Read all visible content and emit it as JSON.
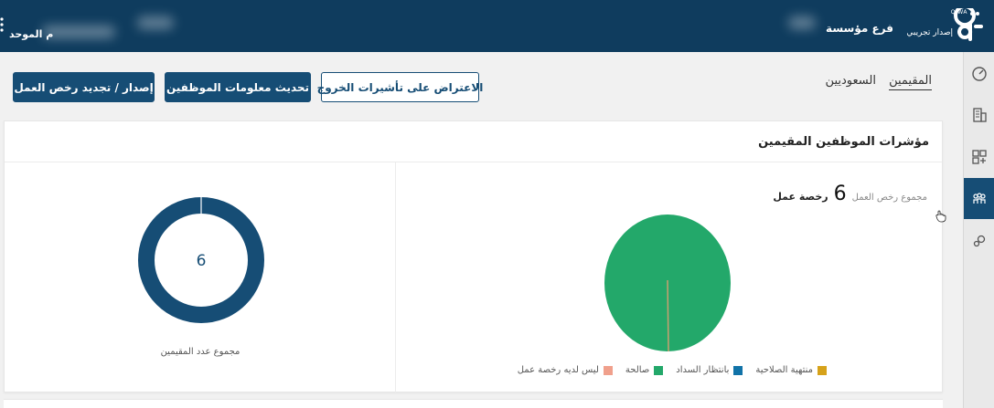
{
  "header": {
    "logo_label": "QIWA",
    "brand_caption": "إصدار تجريبي",
    "branch": "فرع مؤسسة",
    "unified_number_suffix": "م الموحد"
  },
  "sidebar": {
    "items": [
      {
        "icon": "dashboard-icon",
        "active": false
      },
      {
        "icon": "building-icon",
        "active": false
      },
      {
        "icon": "apps-add-icon",
        "active": false
      },
      {
        "icon": "employees-icon",
        "active": true
      },
      {
        "icon": "settings-gears-icon",
        "active": false
      }
    ]
  },
  "tabs": [
    {
      "label": "المقيمين",
      "active": true
    },
    {
      "label": "السعوديين",
      "active": false
    }
  ],
  "actions": {
    "exit_visa_objection": "الاعتراض على تأشيرات الخروج",
    "update_employee_info": "تحديث معلومات الموظفين",
    "issue_renew_permits": "إصدار / تجديد رخص العمل"
  },
  "card": {
    "title": "مؤشرات الموظفين المقيمين",
    "permits_total_label": "مجموع رخص العمل",
    "permits_total": "6",
    "permits_unit": "رخصة عمل",
    "residents_total": "6",
    "residents_total_label": "مجموع عدد المقيمين"
  },
  "colors": {
    "primary": "#164d75",
    "topbar": "#0f3c5e",
    "valid": "#23a86a",
    "pending_payment": "#1173a8",
    "expired": "#d6a21a",
    "no_permit": "#f0a08c"
  },
  "chart_data": [
    {
      "type": "pie",
      "categories": [
        "صالحة",
        "بانتظار السداد",
        "منتهية الصلاحية",
        "ليس لديه رخصة عمل"
      ],
      "values": [
        6,
        0,
        0,
        0
      ],
      "legend": [
        "منتهية الصلاحية",
        "بانتظار السداد",
        "صالحة",
        "ليس لديه رخصة عمل"
      ],
      "legend_position": "bottom"
    },
    {
      "type": "pie",
      "categories": [
        "المقيمين"
      ],
      "values": [
        6
      ],
      "center_label": "6",
      "caption": "مجموع عدد المقيمين"
    }
  ]
}
